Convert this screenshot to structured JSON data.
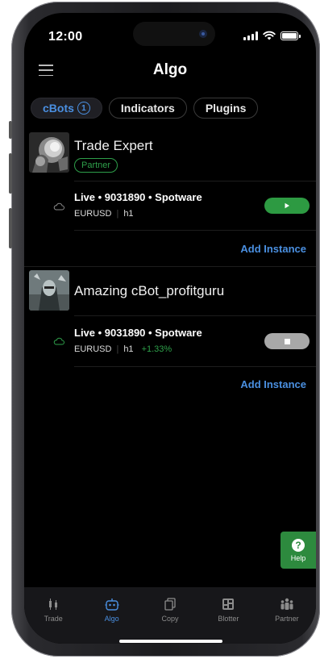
{
  "status_bar": {
    "time": "12:00"
  },
  "header": {
    "title": "Algo"
  },
  "tabs": [
    {
      "label": "cBots",
      "badge": "1",
      "active": true
    },
    {
      "label": "Indicators",
      "active": false
    },
    {
      "label": "Plugins",
      "active": false
    }
  ],
  "bots": [
    {
      "name": "Trade Expert",
      "tag": "Partner",
      "instance": {
        "title": "Live • 9031890 • Spotware",
        "symbol": "EURUSD",
        "timeframe": "h1",
        "gain": "",
        "state": "stopped",
        "status_color": "#2d9a42"
      },
      "add_instance": "Add Instance"
    },
    {
      "name": "Amazing cBot_profitguru",
      "tag": "",
      "instance": {
        "title": "Live • 9031890 • Spotware",
        "symbol": "EURUSD",
        "timeframe": "h1",
        "gain": "+1.33%",
        "state": "running",
        "status_color": "#a8a8a8"
      },
      "add_instance": "Add Instance"
    }
  ],
  "help": {
    "label": "Help",
    "icon": "question-icon"
  },
  "bottom_nav": [
    {
      "label": "Trade",
      "icon": "trade-icon",
      "active": false
    },
    {
      "label": "Algo",
      "icon": "robot-icon",
      "active": true
    },
    {
      "label": "Copy",
      "icon": "copy-icon",
      "active": false
    },
    {
      "label": "Blotter",
      "icon": "blotter-icon",
      "active": false
    },
    {
      "label": "Partner",
      "icon": "partner-icon",
      "active": false
    }
  ],
  "colors": {
    "accent": "#4a8fe0",
    "green": "#2d9a42",
    "background": "#000000"
  }
}
